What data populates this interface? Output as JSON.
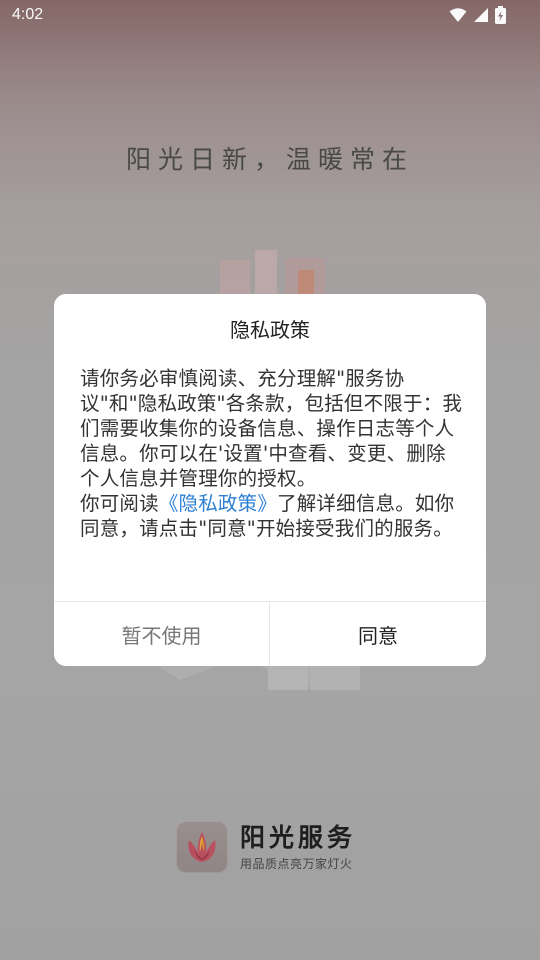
{
  "status_bar": {
    "time": "4:02"
  },
  "splash": {
    "slogan": "阳光日新，温暖常在"
  },
  "dialog": {
    "title": "隐私政策",
    "body_part1": "请你务必审慎阅读、充分理解\"服务协议\"和\"隐私政策\"各条款，包括但不限于：我们需要收集你的设备信息、操作日志等个人信息。你可以在'设置'中查看、变更、删除个人信息并管理你的授权。",
    "body_part2_prefix": "你可阅读",
    "policy_link": "《隐私政策》",
    "body_part2_suffix": "了解详细信息。如你同意，请点击\"同意\"开始接受我们的服务。",
    "decline_label": "暂不使用",
    "agree_label": "同意"
  },
  "brand": {
    "name": "阳光服务",
    "tagline": "用品质点亮万家灯火"
  },
  "colors": {
    "link": "#2d7fd4",
    "dialog_bg": "#ffffff"
  }
}
